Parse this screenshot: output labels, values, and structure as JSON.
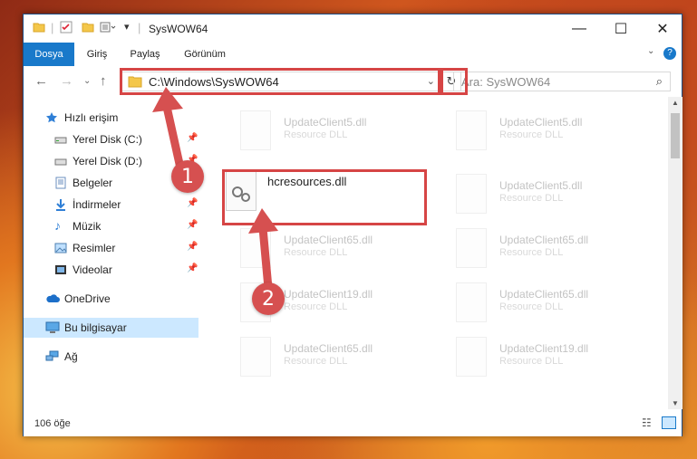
{
  "window": {
    "title": "SysWOW64",
    "controls": {
      "minimize": "—",
      "maximize": "☐",
      "close": "✕"
    }
  },
  "ribbon": {
    "tabs": [
      {
        "label": "Dosya",
        "active": true
      },
      {
        "label": "Giriş"
      },
      {
        "label": "Paylaş"
      },
      {
        "label": "Görünüm"
      }
    ],
    "help": "?"
  },
  "address": {
    "path": "C:\\Windows\\SysWOW64",
    "search_placeholder": "Ara: SysWOW64"
  },
  "nav": {
    "items": [
      {
        "label": "Hızlı erişim",
        "icon": "star-icon"
      },
      {
        "label": "Yerel Disk (C:)",
        "icon": "drive-icon",
        "pinned": true
      },
      {
        "label": "Yerel Disk (D:)",
        "icon": "drive-icon",
        "pinned": true
      },
      {
        "label": "Belgeler",
        "icon": "documents-icon",
        "pinned": true
      },
      {
        "label": "İndirmeler",
        "icon": "download-icon",
        "pinned": true
      },
      {
        "label": "Müzik",
        "icon": "music-icon",
        "pinned": true
      },
      {
        "label": "Resimler",
        "icon": "pictures-icon",
        "pinned": true
      },
      {
        "label": "Videolar",
        "icon": "video-icon",
        "pinned": true
      },
      {
        "label": "OneDrive",
        "icon": "cloud-icon"
      },
      {
        "label": "Bu bilgisayar",
        "icon": "computer-icon",
        "selected": true
      },
      {
        "label": "Ağ",
        "icon": "network-icon"
      }
    ]
  },
  "files": {
    "highlighted": {
      "name": "hcresources.dll"
    },
    "faded": [
      {
        "name": "UpdateClient5.dll",
        "type": "Resource DLL"
      },
      {
        "name": "UpdateClient5.dll",
        "type": "Resource DLL"
      },
      {
        "name": "UpdateClient5.dll",
        "type": "Resource DLL"
      },
      {
        "name": "UpdateClient65.dll",
        "type": "Resource DLL"
      },
      {
        "name": "UpdateClient65.dll",
        "type": "Resource DLL"
      },
      {
        "name": "UpdateClient19.dll",
        "type": "Resource DLL"
      },
      {
        "name": "UpdateClient65.dll",
        "type": "Resource DLL"
      },
      {
        "name": "UpdateClient65.dll",
        "type": "Resource DLL"
      },
      {
        "name": "UpdateClient19.dll",
        "type": "Resource DLL"
      }
    ]
  },
  "status": {
    "count": "106 öğe"
  },
  "annotations": {
    "step1": "1",
    "step2": "2",
    "color": "#d65050"
  }
}
